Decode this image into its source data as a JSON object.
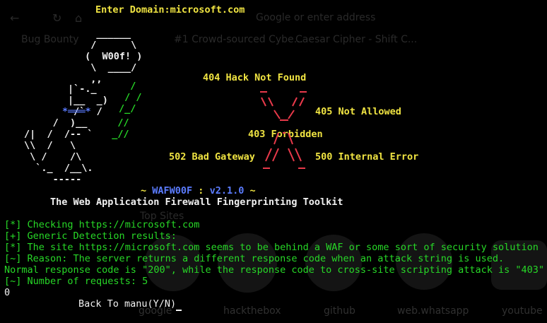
{
  "background_browser": {
    "tabs": [
      "Bug Bounty",
      "#1 Crowd-sourced Cybe...",
      "Caesar Cipher - Shift C..."
    ],
    "search_hint": "Google or enter address",
    "top_sites_label": "Top Sites",
    "shortcuts": [
      "google",
      "hackthebox",
      "github",
      "web.whatsapp",
      "youtube"
    ]
  },
  "terminal": {
    "prompt_label": "Enter Domain:",
    "prompt_value": "microsoft.com",
    "logo_text": "W00f!",
    "codes": {
      "c404": "404 Hack Not Found",
      "c405": "405 Not Allowed",
      "c403": "403 Forbidden",
      "c502": "502 Bad Gateway",
      "c500": "500 Internal Error"
    },
    "title_tilde_left": "~ ",
    "title_name": "WAFW00F",
    "title_sep": " : ",
    "title_version": "v2.1.0",
    "title_tilde_right": " ~",
    "subtitle": "The Web Application Firewall Fingerprinting Toolkit",
    "output": [
      {
        "prefix": "[*]",
        "text": " Checking https://microsoft.com"
      },
      {
        "prefix": "[+]",
        "text": " Generic Detection results:"
      },
      {
        "prefix": "[*]",
        "text": " The site https://microsoft.com seems to be behind a WAF or some sort of security solution"
      },
      {
        "prefix": "[~]",
        "text": " Reason: The server returns a different response code when an attack string is used."
      },
      {
        "prefix": "",
        "text": "Normal response code is \"200\", while the response code to cross-site scripting attack is \"403\""
      },
      {
        "prefix": "[~]",
        "text": " Number of requests: 5"
      }
    ],
    "exit_code": "0",
    "back_prompt": "Back To manu(Y/N)"
  }
}
